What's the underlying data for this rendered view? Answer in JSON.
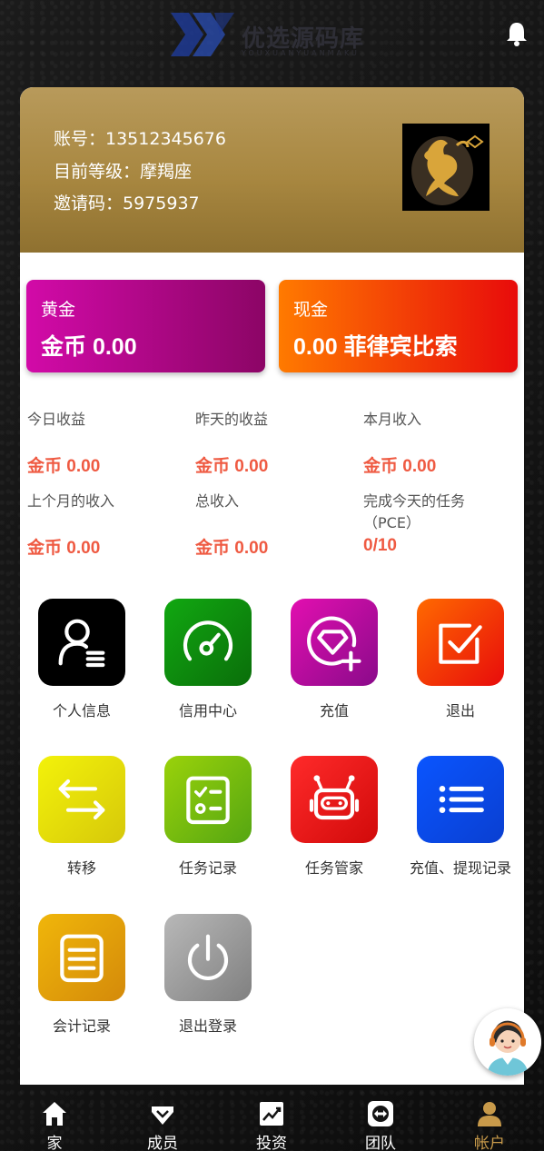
{
  "header": {
    "logo_text": "优选源码库",
    "logo_sub": "YOUXUANYUANMAKU",
    "bell_icon": "bell-icon"
  },
  "profile": {
    "account_line": "账号：13512345676",
    "level_line": "目前等级：摩羯座",
    "invite_line": "邀请码：5975937",
    "avatar_icon": "capricorn-avatar"
  },
  "wallets": {
    "gold": {
      "title": "黄金",
      "amount": "金币 0.00",
      "colors": [
        "#d20aa8",
        "#8c0566"
      ]
    },
    "cash": {
      "title": "现金",
      "amount": "0.00 菲律宾比索",
      "colors": [
        "#ff7a00",
        "#e80b0b"
      ]
    }
  },
  "stats": [
    {
      "label": "今日收益",
      "value": "金币 0.00"
    },
    {
      "label": "昨天的收益",
      "value": "金币 0.00"
    },
    {
      "label": "本月收入",
      "value": "金币 0.00"
    },
    {
      "label": "上个月的收入",
      "value": "金币 0.00"
    },
    {
      "label": "总收入",
      "value": "金币 0.00"
    },
    {
      "label": "完成今天的任务（PCE）",
      "value": "0/10"
    }
  ],
  "menu": [
    {
      "label": "个人信息",
      "icon": "user-profile-icon"
    },
    {
      "label": "信用中心",
      "icon": "gauge-icon"
    },
    {
      "label": "充值",
      "icon": "diamond-plus-icon"
    },
    {
      "label": "退出",
      "icon": "checkbox-icon"
    },
    {
      "label": "转移",
      "icon": "transfer-arrows-icon"
    },
    {
      "label": "任务记录",
      "icon": "checklist-icon"
    },
    {
      "label": "任务管家",
      "icon": "robot-icon"
    },
    {
      "label": "充值、提现记录",
      "icon": "list-icon"
    },
    {
      "label": "会计记录",
      "icon": "ledger-icon"
    },
    {
      "label": "退出登录",
      "icon": "power-icon"
    }
  ],
  "support_icon": "customer-service-icon",
  "nav": [
    {
      "label": "家",
      "icon": "home-icon",
      "active": false
    },
    {
      "label": "成员",
      "icon": "member-diamond-icon",
      "active": false
    },
    {
      "label": "投资",
      "icon": "trend-chart-icon",
      "active": false
    },
    {
      "label": "团队",
      "icon": "team-icon",
      "active": false
    },
    {
      "label": "帐户",
      "icon": "account-icon",
      "active": true
    }
  ],
  "colors": {
    "gold_header": "#a88740",
    "stat_value": "#ef5a42",
    "nav_active": "#c89a4a"
  }
}
